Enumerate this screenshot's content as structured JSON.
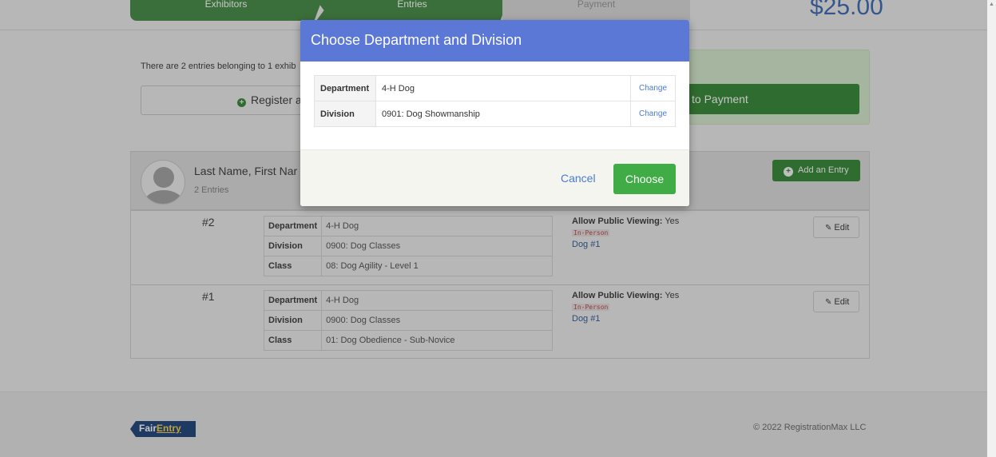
{
  "stepper": {
    "steps": [
      "Exhibitors",
      "Entries",
      "Payment"
    ],
    "total": "$25.00"
  },
  "info": {
    "text": "There are 2 entries belonging to 1 exhib",
    "register_label": "Register a",
    "payment_label": "to Payment"
  },
  "exhibitor": {
    "name": "Last Name, First Nar",
    "entries_count": "2 Entries",
    "add_entry_label": "Add an Entry"
  },
  "entries": [
    {
      "number": "#2",
      "department_key": "Department",
      "department": "4-H Dog",
      "division_key": "Division",
      "division": "0900: Dog Classes",
      "class_key": "Class",
      "class": "08: Dog Agility - Level 1",
      "public_label": "Allow Public Viewing:",
      "public_value": "Yes",
      "tag": "In-Person",
      "animal": "Dog #1",
      "edit_label": "Edit"
    },
    {
      "number": "#1",
      "department_key": "Department",
      "department": "4-H Dog",
      "division_key": "Division",
      "division": "0900: Dog Classes",
      "class_key": "Class",
      "class": "01: Dog Obedience - Sub-Novice",
      "public_label": "Allow Public Viewing:",
      "public_value": "Yes",
      "tag": "In-Person",
      "animal": "Dog #1",
      "edit_label": "Edit"
    }
  ],
  "footer": {
    "logo_fair": "Fair",
    "logo_entry": "Entry",
    "copyright": "© 2022 RegistrationMax LLC"
  },
  "modal": {
    "title": "Choose Department and Division",
    "rows": [
      {
        "key": "Department",
        "value": "4-H Dog",
        "action": "Change"
      },
      {
        "key": "Division",
        "value": "0901: Dog Showmanship",
        "action": "Change"
      }
    ],
    "cancel_label": "Cancel",
    "choose_label": "Choose"
  },
  "colors": {
    "modal_header": "#5b78d6",
    "primary_green": "#3fac45",
    "link_blue": "#4a7ad1"
  }
}
